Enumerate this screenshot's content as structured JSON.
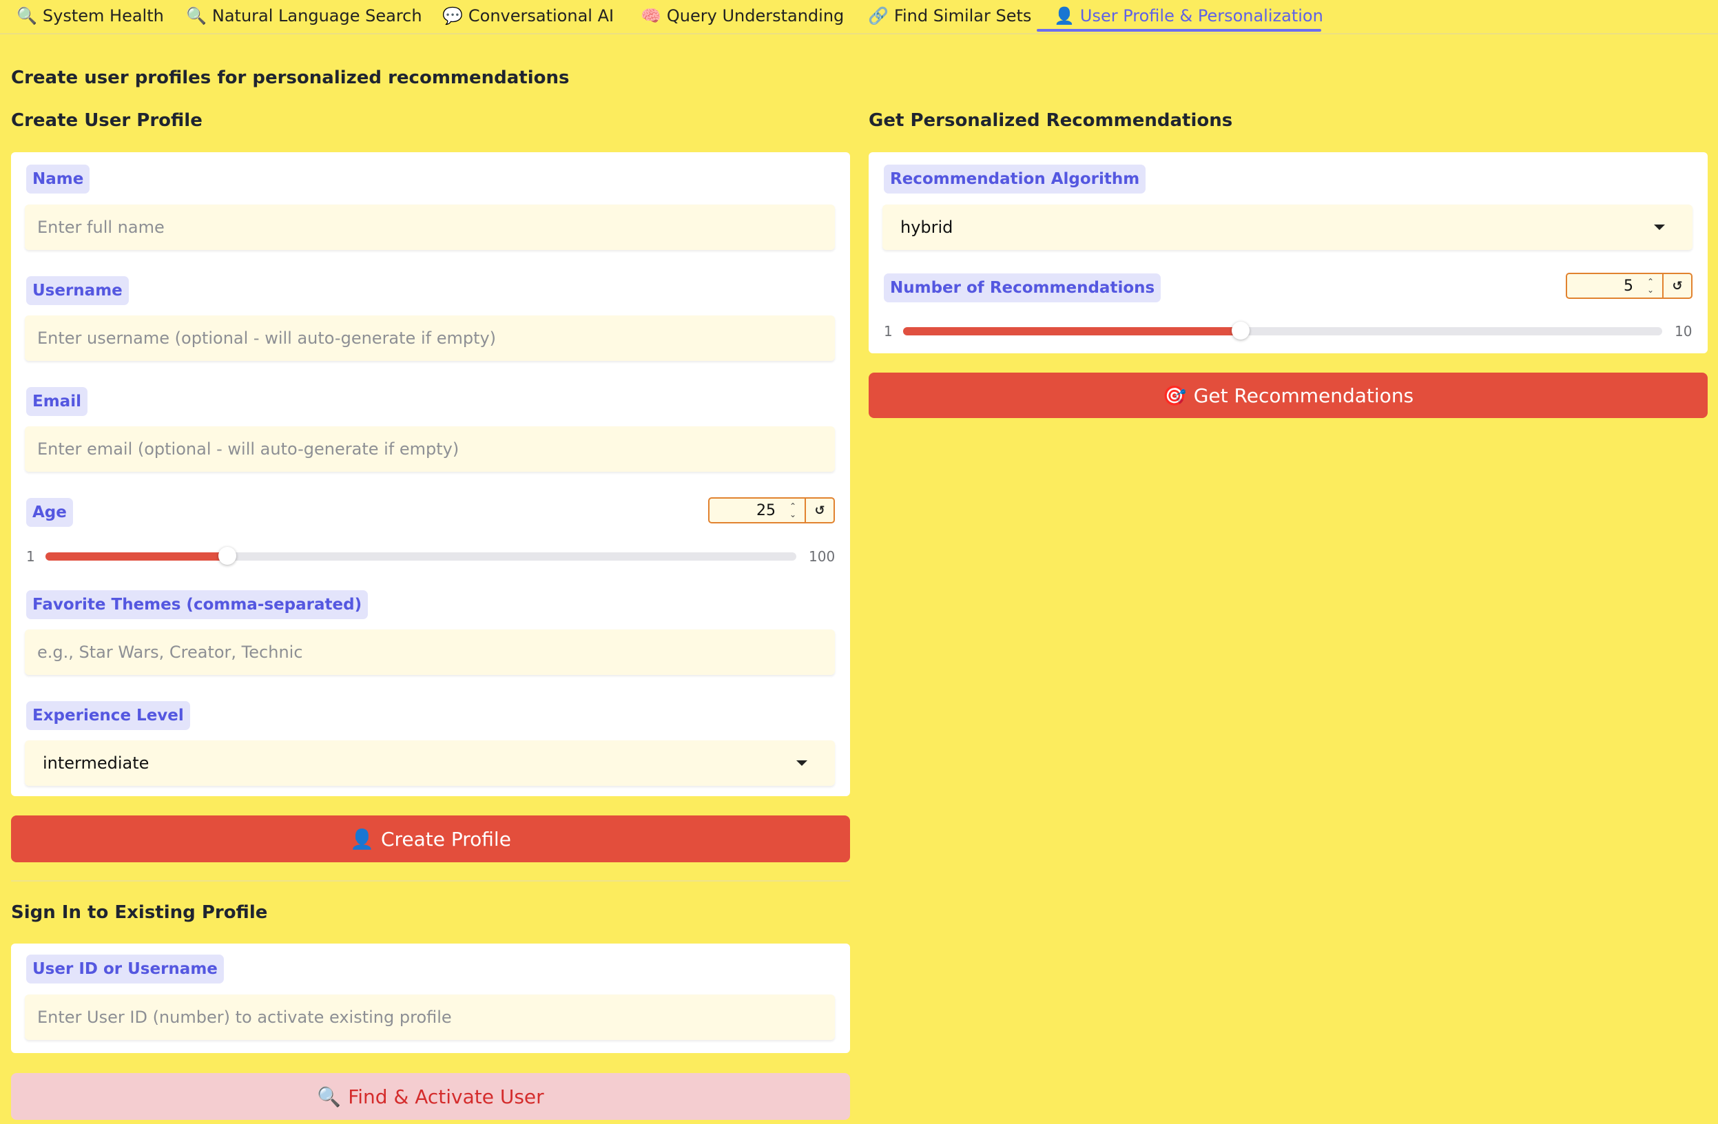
{
  "tabs": [
    {
      "icon": "🔍",
      "label": "System Health"
    },
    {
      "icon": "🔍",
      "label": "Natural Language Search"
    },
    {
      "icon": "💬",
      "label": "Conversational AI"
    },
    {
      "icon": "🧠",
      "label": "Query Understanding"
    },
    {
      "icon": "🔗",
      "label": "Find Similar Sets"
    },
    {
      "icon": "👤",
      "label": "User Profile & Personalization"
    }
  ],
  "active_tab": "User Profile & Personalization",
  "page_subtitle": "Create user profiles for personalized recommendations",
  "create_profile": {
    "heading": "Create User Profile",
    "name": {
      "label": "Name",
      "value": "",
      "placeholder": "Enter full name"
    },
    "username": {
      "label": "Username",
      "value": "",
      "placeholder": "Enter username (optional - will auto-generate if empty)"
    },
    "email": {
      "label": "Email",
      "value": "",
      "placeholder": "Enter email (optional - will auto-generate if empty)"
    },
    "age": {
      "label": "Age",
      "value": "25",
      "min": "1",
      "max": "100",
      "reset_icon": "↺"
    },
    "themes": {
      "label": "Favorite Themes (comma-separated)",
      "value": "",
      "placeholder": "e.g., Star Wars, Creator, Technic"
    },
    "experience": {
      "label": "Experience Level",
      "value": "intermediate"
    },
    "button": {
      "icon": "👤",
      "label": "Create Profile"
    }
  },
  "sign_in": {
    "heading": "Sign In to Existing Profile",
    "user_id": {
      "label": "User ID or Username",
      "value": "",
      "placeholder": "Enter User ID (number) to activate existing profile"
    },
    "button": {
      "icon": "🔍",
      "label": "Find & Activate User"
    }
  },
  "recommendations": {
    "heading": "Get Personalized Recommendations",
    "algorithm": {
      "label": "Recommendation Algorithm",
      "value": "hybrid"
    },
    "count": {
      "label": "Number of Recommendations",
      "value": "5",
      "min": "1",
      "max": "10",
      "reset_icon": "↺"
    },
    "button": {
      "icon": "🎯",
      "label": "Get Recommendations"
    }
  },
  "colors": {
    "background": "#fcec5e",
    "accent": "#e34e3c",
    "label_text": "#5457e0",
    "label_bg": "#e3e4fb",
    "active_tab": "#5f62e6"
  }
}
